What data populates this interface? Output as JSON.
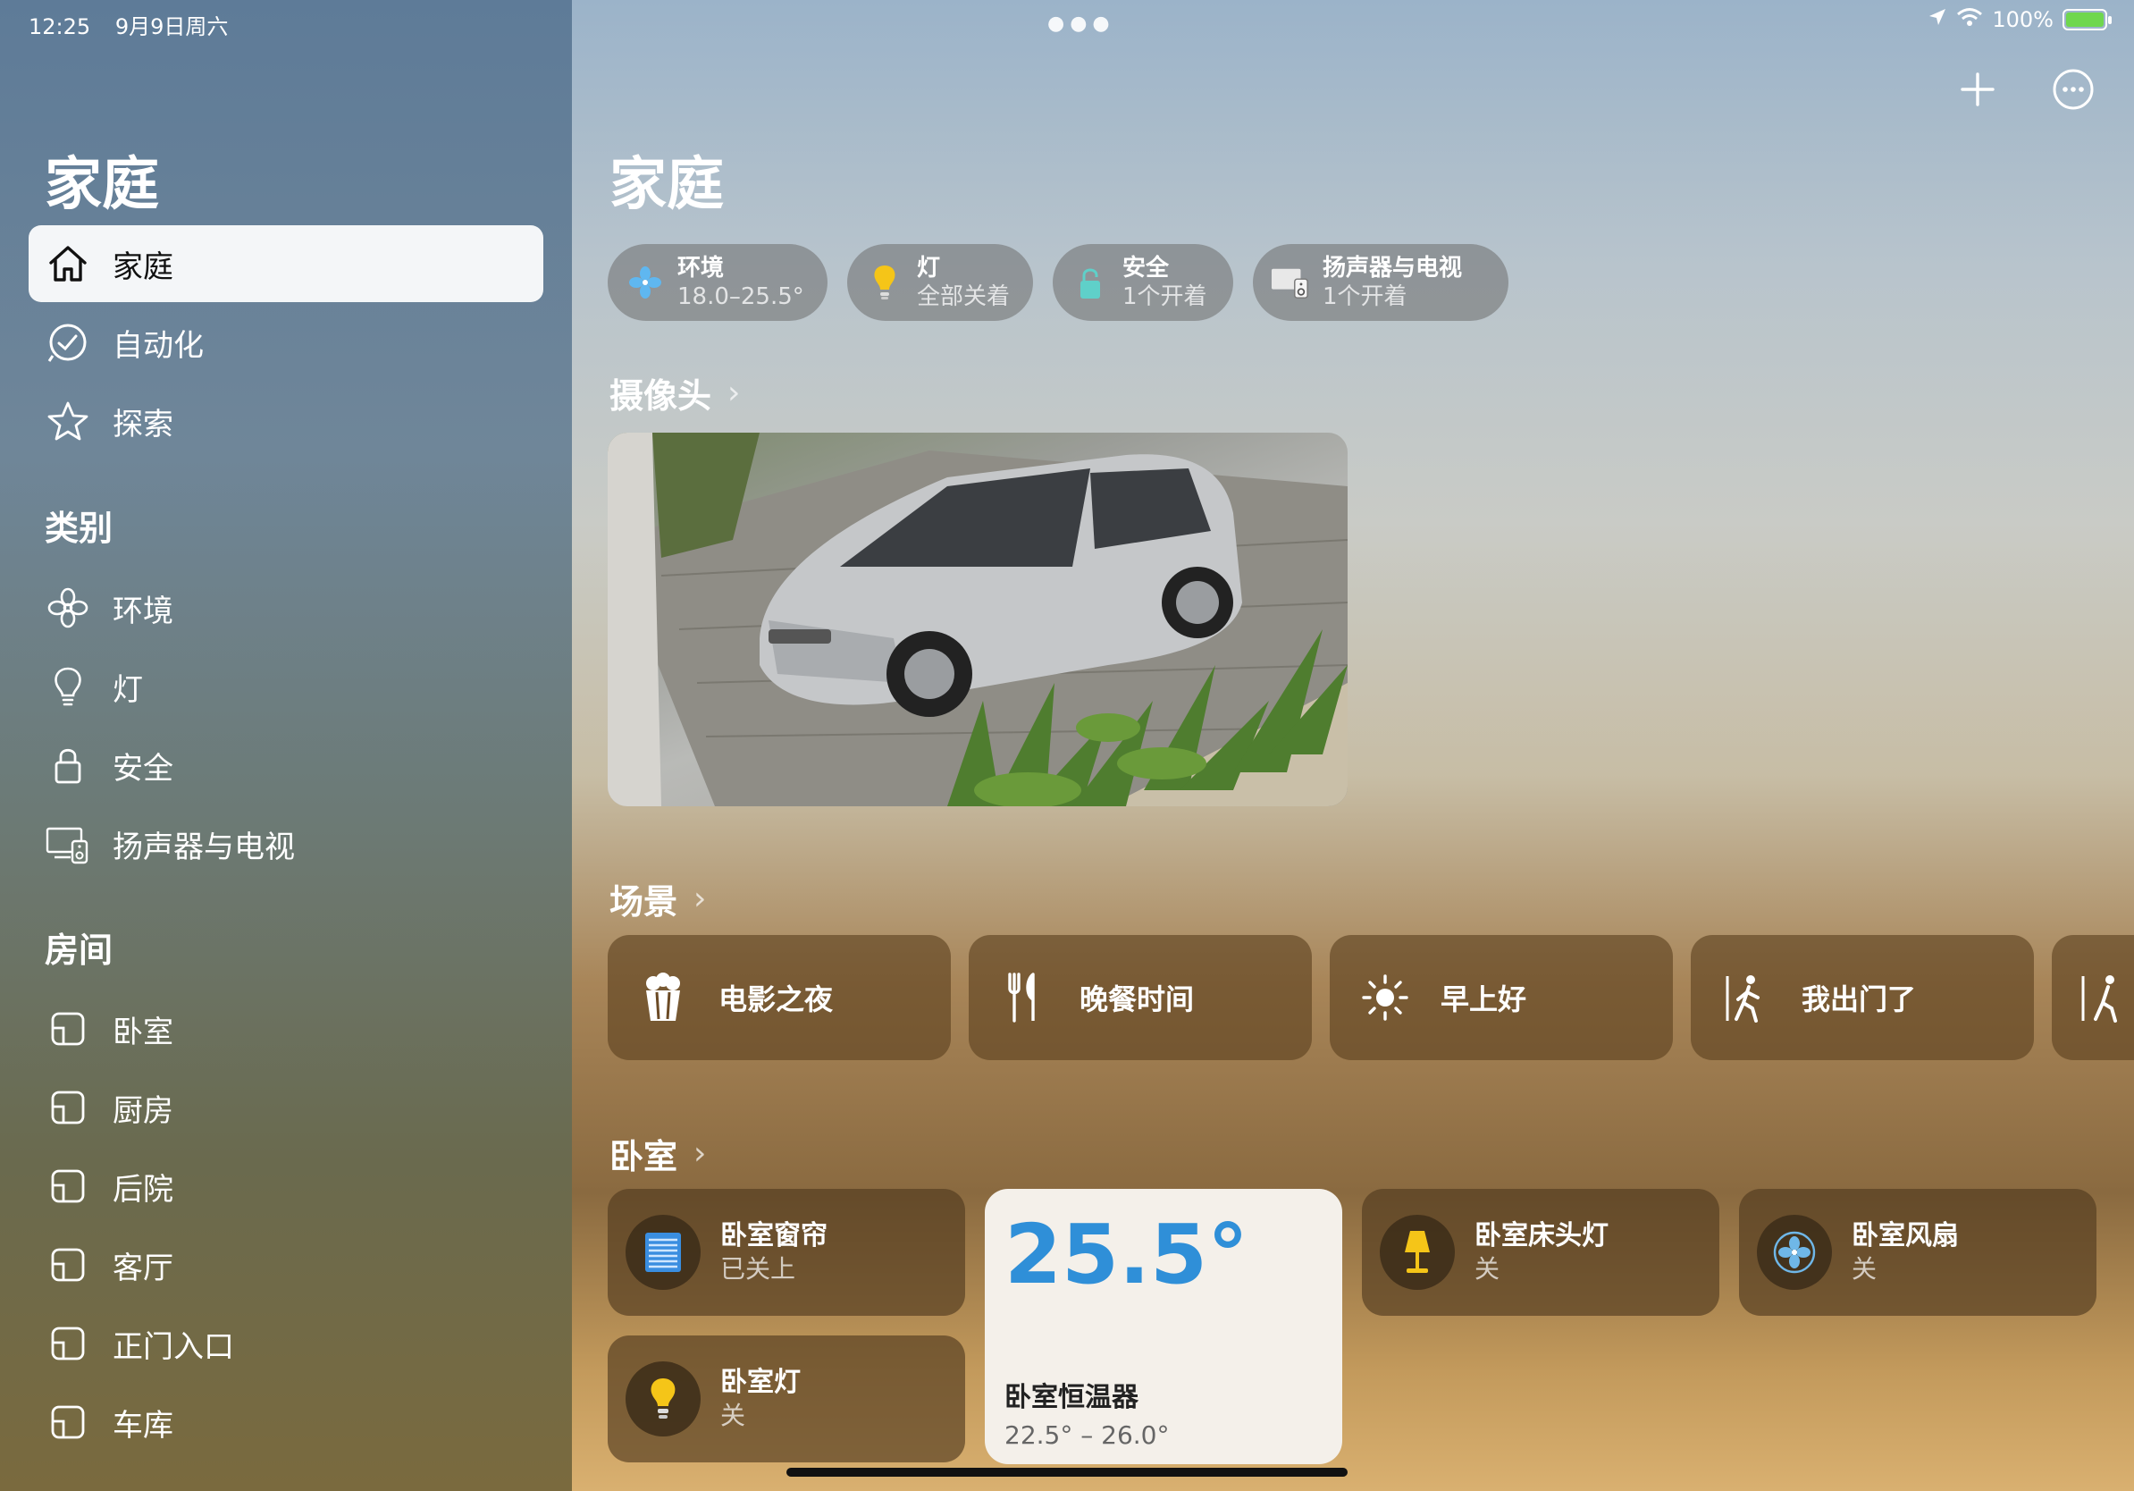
{
  "status": {
    "time": "12:25",
    "date": "9月9日周六",
    "battery": "100%"
  },
  "sidebar": {
    "title": "家庭",
    "nav": [
      {
        "label": "家庭",
        "icon": "house-icon"
      },
      {
        "label": "自动化",
        "icon": "clock-icon"
      },
      {
        "label": "探索",
        "icon": "star-icon"
      }
    ],
    "categories_title": "类别",
    "categories": [
      {
        "label": "环境",
        "icon": "fan-icon"
      },
      {
        "label": "灯",
        "icon": "lightbulb-icon"
      },
      {
        "label": "安全",
        "icon": "lock-icon"
      },
      {
        "label": "扬声器与电视",
        "icon": "speaker-tv-icon"
      }
    ],
    "rooms_title": "房间",
    "rooms": [
      {
        "label": "卧室"
      },
      {
        "label": "厨房"
      },
      {
        "label": "后院"
      },
      {
        "label": "客厅"
      },
      {
        "label": "正门入口"
      },
      {
        "label": "车库"
      }
    ]
  },
  "main": {
    "title": "家庭",
    "chips": [
      {
        "title": "环境",
        "sub": "18.0–25.5°",
        "icon": "fan-icon"
      },
      {
        "title": "灯",
        "sub": "全部关着",
        "icon": "lightbulb-icon"
      },
      {
        "title": "安全",
        "sub": "1个开着",
        "icon": "lock-icon"
      },
      {
        "title": "扬声器与电视",
        "sub": "1个开着",
        "icon": "speaker-tv-icon"
      }
    ],
    "cameras_label": "摄像头",
    "scenes_label": "场景",
    "scenes": [
      {
        "label": "电影之夜",
        "icon": "popcorn-icon"
      },
      {
        "label": "晚餐时间",
        "icon": "fork-knife-icon"
      },
      {
        "label": "早上好",
        "icon": "sun-icon"
      },
      {
        "label": "我出门了",
        "icon": "walk-out-icon"
      }
    ],
    "bedroom_label": "卧室",
    "tiles": [
      {
        "name": "卧室窗帘",
        "status": "已关上",
        "icon": "blinds-icon"
      },
      {
        "name": "卧室床头灯",
        "status": "关",
        "icon": "lamp-icon"
      },
      {
        "name": "卧室风扇",
        "status": "关",
        "icon": "fan-icon"
      },
      {
        "name": "卧室灯",
        "status": "关",
        "icon": "lightbulb-icon"
      }
    ],
    "thermostat": {
      "temp": "25.5°",
      "name": "卧室恒温器",
      "range": "22.5° – 26.0°"
    }
  },
  "colors": {
    "accent_blue": "#2f8fd8",
    "bulb_yellow": "#f5c518",
    "lock_teal": "#5fd0c9",
    "battery_green": "#6fd74e"
  }
}
